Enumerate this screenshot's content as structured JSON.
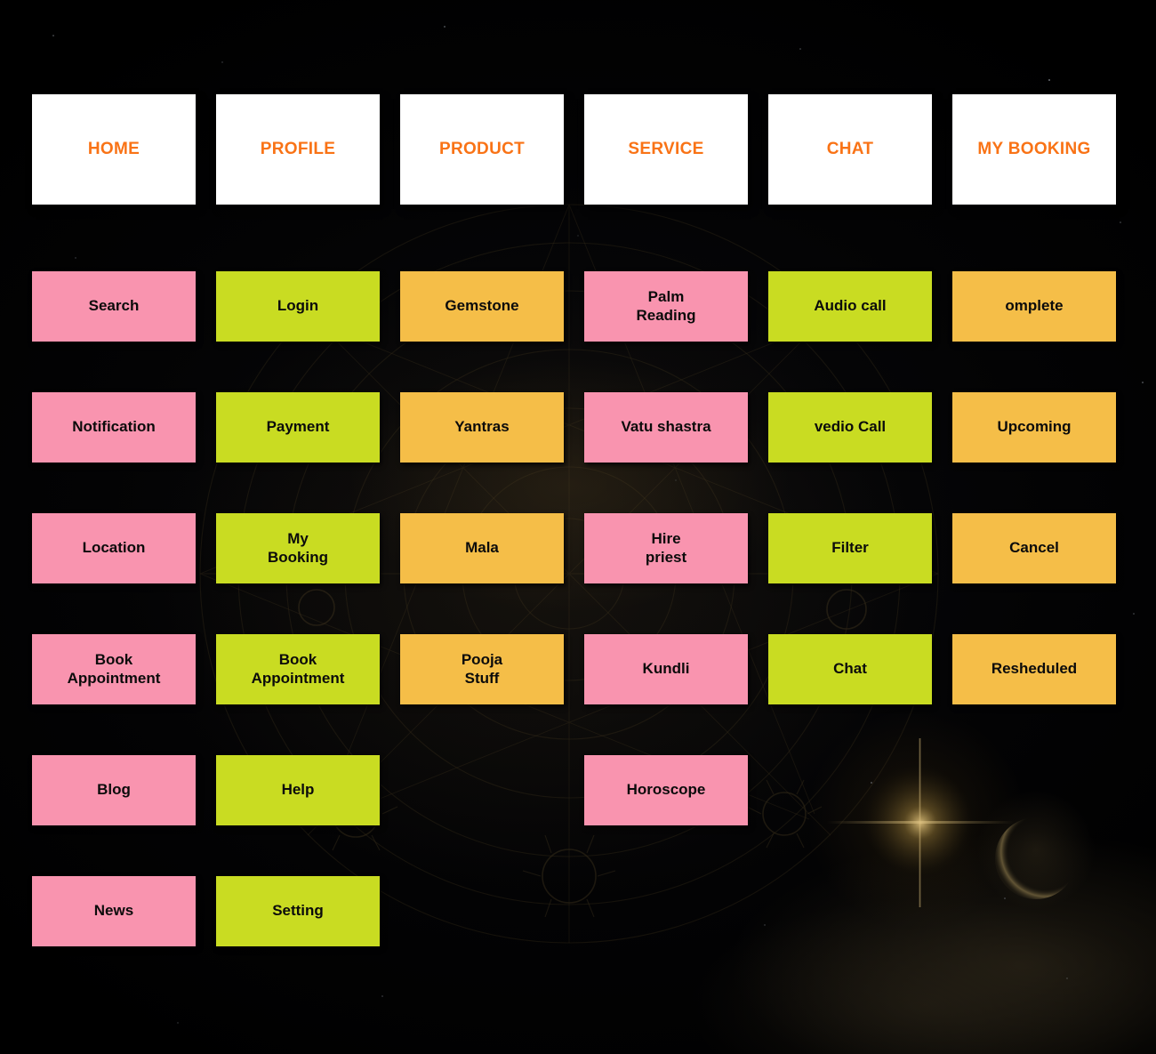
{
  "palette": {
    "background": "#000000",
    "header_bg": "#FFFFFF",
    "header_text": "#F97316",
    "pink": "#F994AF",
    "lime": "#C9DC22",
    "orange": "#F5BE48",
    "cell_text": "#0B0B0B"
  },
  "header": {
    "columns": [
      {
        "label": "HOME"
      },
      {
        "label": "PROFILE"
      },
      {
        "label": "PRODUCT"
      },
      {
        "label": "SERVICE"
      },
      {
        "label": "CHAT"
      },
      {
        "label": "MY BOOKING"
      }
    ]
  },
  "columns": [
    {
      "name": "home",
      "color": "pink",
      "items": [
        "Search",
        "Notification",
        "Location",
        "Book\nAppointment",
        "Blog",
        "News"
      ]
    },
    {
      "name": "profile",
      "color": "lime",
      "items": [
        "Login",
        "Payment",
        "My\nBooking",
        "Book\nAppointment",
        "Help",
        "Setting"
      ]
    },
    {
      "name": "product",
      "color": "orange",
      "items": [
        "Gemstone",
        "Yantras",
        "Mala",
        "Pooja\nStuff",
        "",
        ""
      ]
    },
    {
      "name": "service",
      "color": "pink",
      "items": [
        "Palm\nReading",
        "Vatu shastra",
        "Hire\npriest",
        "Kundli",
        "Horoscope",
        ""
      ]
    },
    {
      "name": "chat",
      "color": "lime",
      "items": [
        "Audio call",
        "vedio Call",
        "Filter",
        "Chat",
        "",
        ""
      ]
    },
    {
      "name": "my-booking",
      "color": "orange",
      "items": [
        "omplete",
        "Upcoming",
        "Cancel",
        "Resheduled",
        "",
        ""
      ]
    }
  ]
}
